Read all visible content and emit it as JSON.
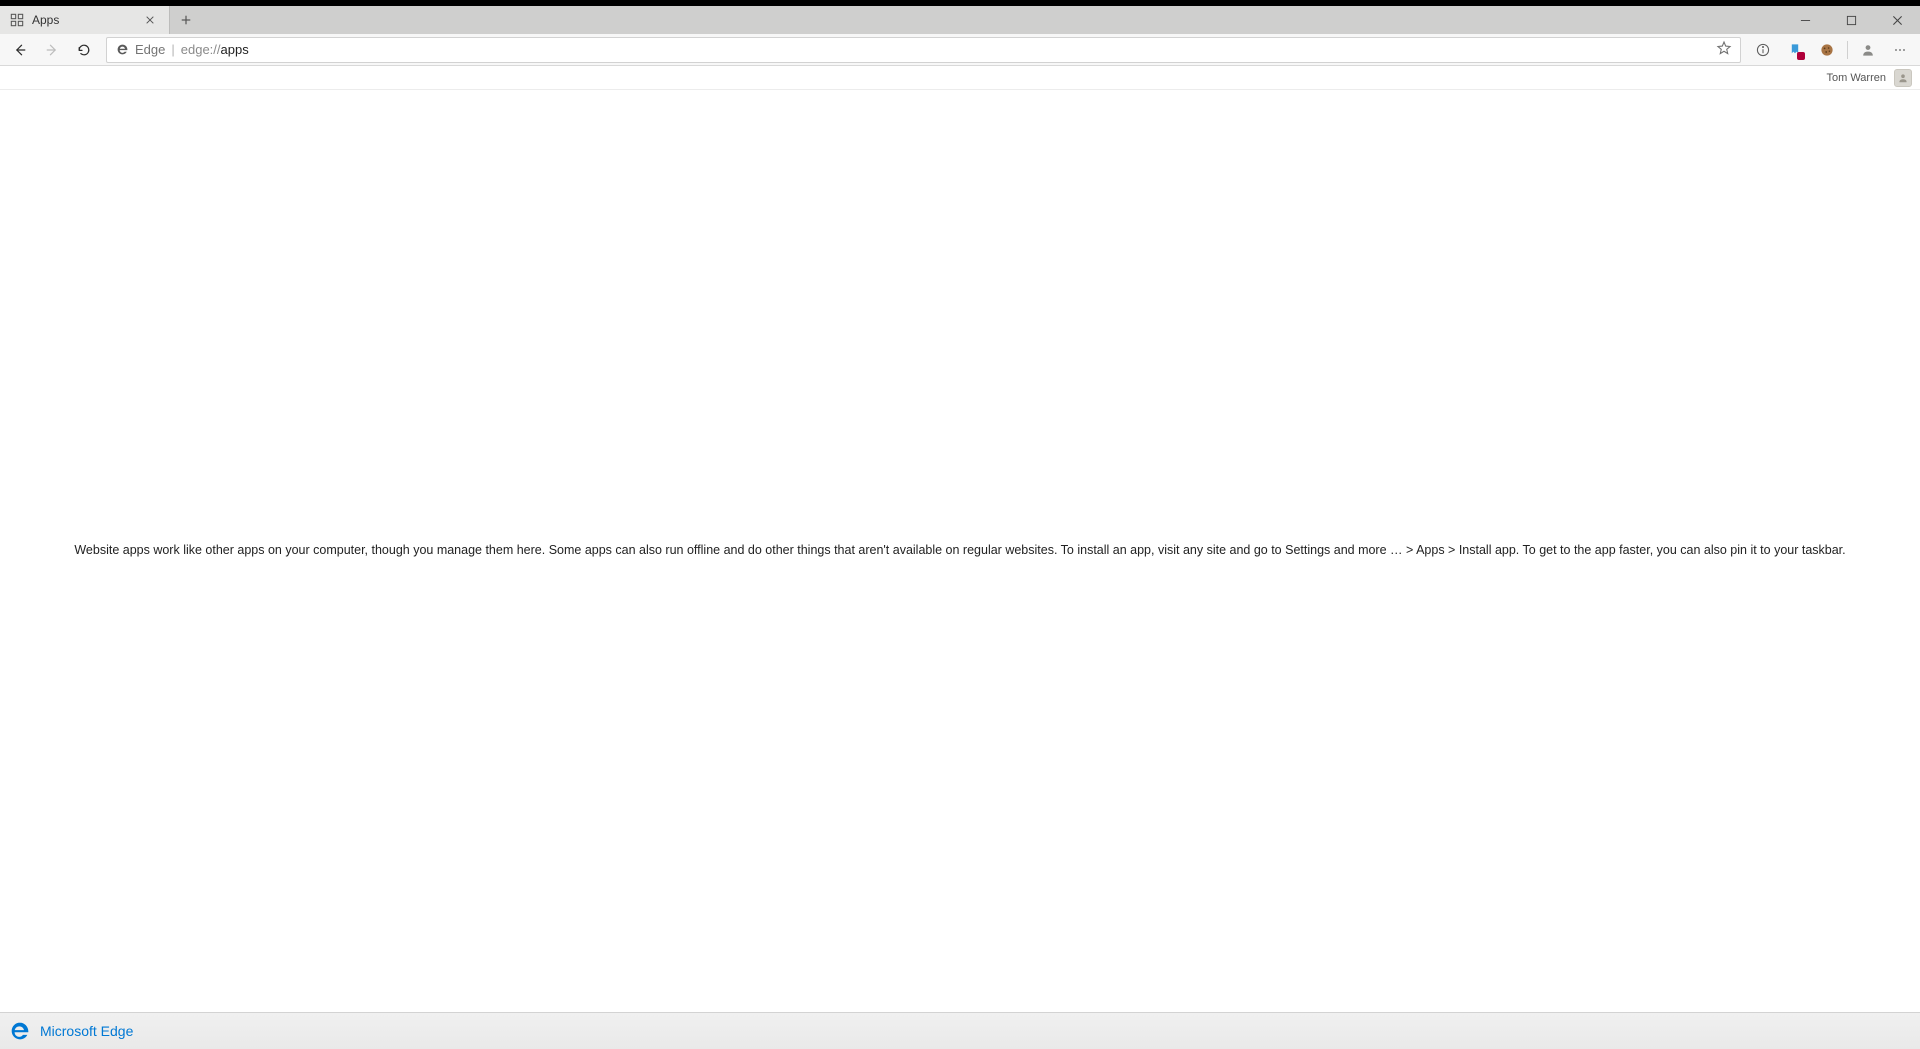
{
  "tab": {
    "title": "Apps"
  },
  "address": {
    "origin_label": "Edge",
    "url_prefix": "edge://",
    "url_path": "apps"
  },
  "profile": {
    "name": "Tom Warren"
  },
  "content": {
    "message": "Website apps work like other apps on your computer, though you manage them here. Some apps can also run offline and do other things that aren't available on regular websites. To install an app, visit any site and go to Settings and more … > Apps > Install app. To get to the app faster, you can also pin it to your taskbar."
  },
  "taskbar": {
    "label": "Microsoft Edge"
  }
}
